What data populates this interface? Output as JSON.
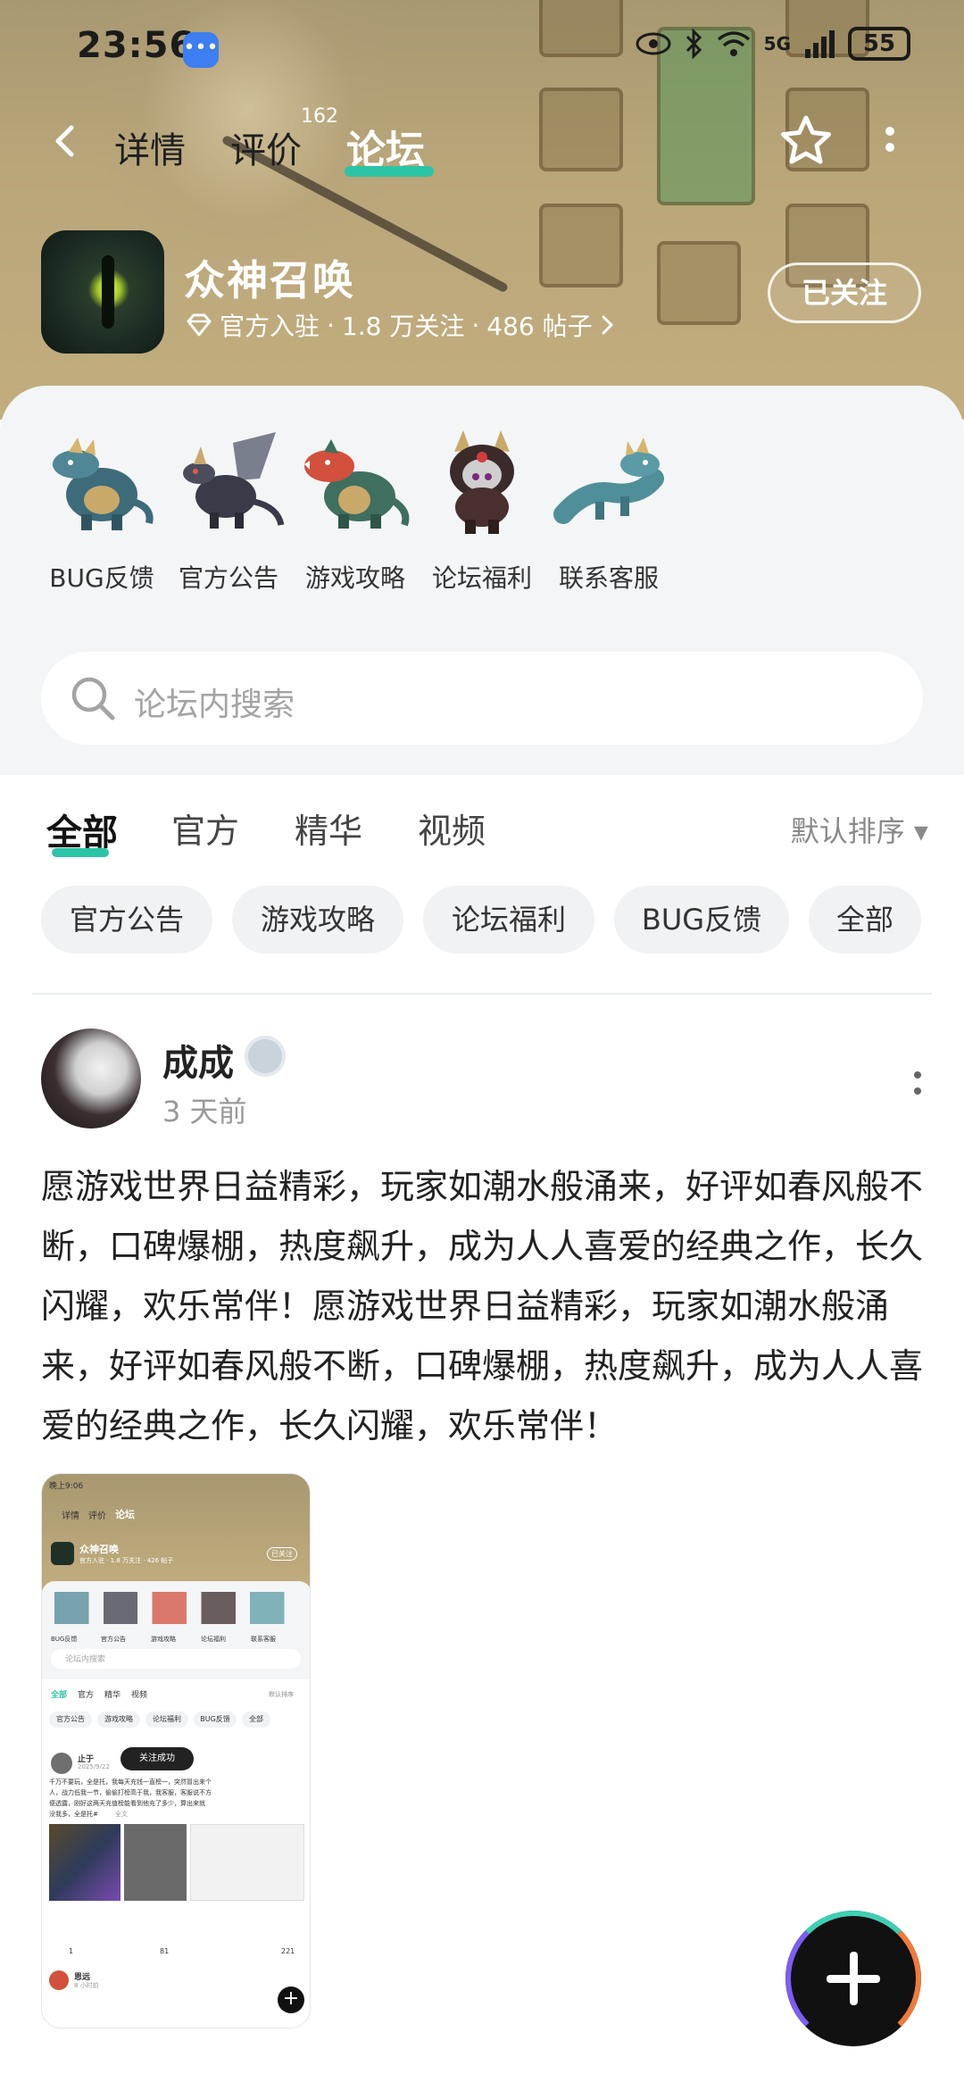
{
  "status_bar": {
    "time": "23:56",
    "network": "5G",
    "battery": "55"
  },
  "nav": {
    "tabs": [
      {
        "label": "详情"
      },
      {
        "label": "评价",
        "badge": "162"
      },
      {
        "label": "论坛"
      }
    ],
    "active_tab": "论坛"
  },
  "game": {
    "name": "众神召唤",
    "verified_label": "官方入驻",
    "followers": "1.8 万关注",
    "posts": "486 帖子",
    "separator": "·",
    "follow_button": "已关注"
  },
  "shortcuts": [
    {
      "label": "BUG反馈"
    },
    {
      "label": "官方公告"
    },
    {
      "label": "游戏攻略"
    },
    {
      "label": "论坛福利"
    },
    {
      "label": "联系客服"
    }
  ],
  "search": {
    "placeholder": "论坛内搜索"
  },
  "filter_tabs": [
    {
      "label": "全部"
    },
    {
      "label": "官方"
    },
    {
      "label": "精华"
    },
    {
      "label": "视频"
    }
  ],
  "sort": {
    "label": "默认排序 ▾"
  },
  "chips": [
    {
      "label": "官方公告"
    },
    {
      "label": "游戏攻略"
    },
    {
      "label": "论坛福利"
    },
    {
      "label": "BUG反馈"
    },
    {
      "label": "全部"
    }
  ],
  "post": {
    "author": "成成",
    "time": "3 天前",
    "content": "愿游戏世界日益精彩，玩家如潮水般涌来，好评如春风般不断，口碑爆棚，热度飙升，成为人人喜爱的经典之作，长久闪耀，欢乐常伴！愿游戏世界日益精彩，玩家如潮水般涌来，好评如春风般不断，口碑爆棚，热度飙升，成为人人喜爱的经典之作，长久闪耀，欢乐常伴！"
  },
  "embedded": {
    "time": "晚上9:06",
    "tabs": [
      "详情",
      "评价",
      "论坛"
    ],
    "game_name": "众神召唤",
    "game_meta": "官方入驻 · 1.8 万关注 · 426 帖子",
    "follow": "已关注",
    "shortcuts": [
      "BUG反馈",
      "官方公告",
      "游戏攻略",
      "论坛福利",
      "联系客服"
    ],
    "search": "论坛内搜索",
    "filter_tabs": [
      "全部",
      "官方",
      "精华",
      "视频"
    ],
    "sort": "默认排序",
    "chips": [
      "官方公告",
      "游戏攻略",
      "论坛福利",
      "BUG反馈",
      "全部"
    ],
    "toast": "关注成功",
    "post_author": "止于",
    "post_date": "2025/9/22",
    "post_text": [
      "千万不要玩，全是托，我每天充钱一直榜一，突然冒出来个",
      "人，战力低我一节，偷偷打榜高于我，我客服，客服说不方",
      "便透露，刚好这两天充值榜能看到他充了多少，算出来就",
      "没我多，全是托#"
    ],
    "post_more": "全文",
    "repost": "1",
    "comments": "81",
    "likes": "221",
    "next_author": "恩远",
    "next_time": "8 小时前"
  },
  "colors": {
    "accent": "#2cc4a6",
    "hero": "#b9a679",
    "panel": "#f4f5f7"
  },
  "icons": {
    "back": "chevron-left-icon",
    "star": "star-outline-icon",
    "more": "more-vertical-icon",
    "search": "search-icon",
    "verified": "diamond-icon",
    "add": "plus-icon"
  }
}
